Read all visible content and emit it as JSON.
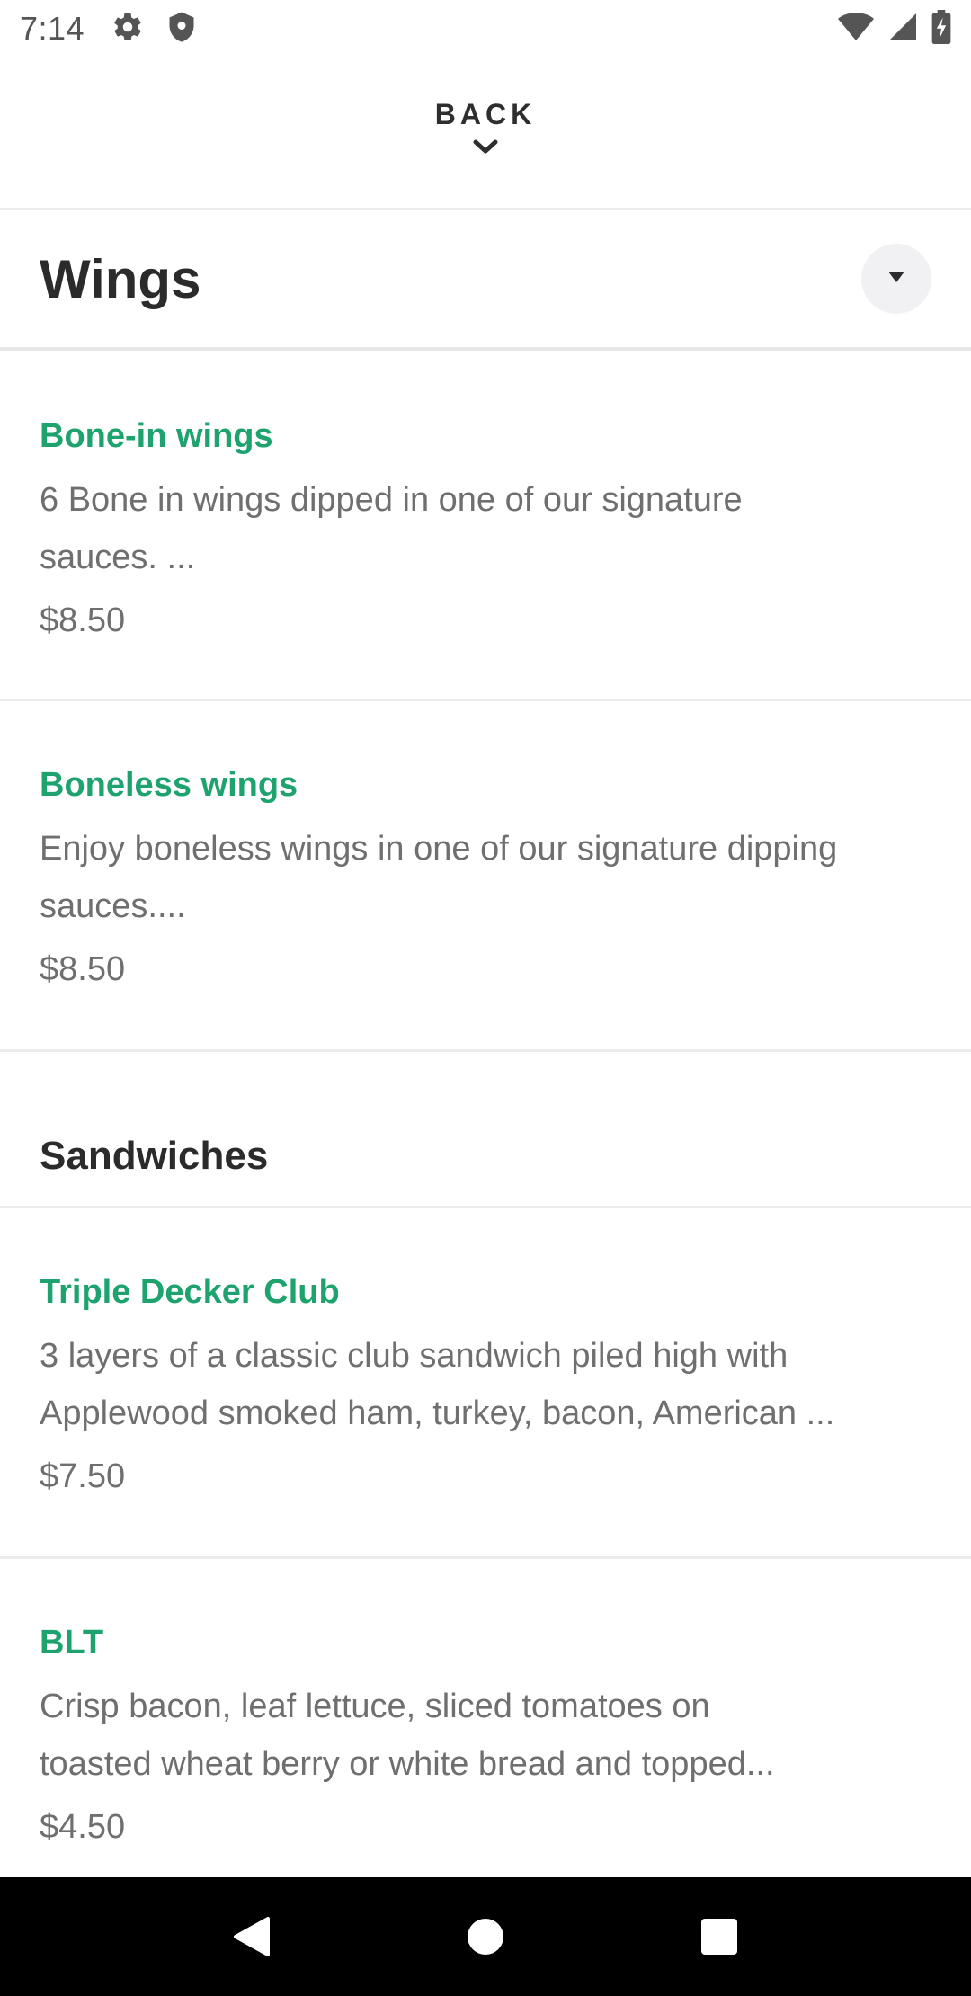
{
  "status_bar": {
    "time": "7:14",
    "left_icons": [
      "gear-icon",
      "shield-icon"
    ],
    "right_icons": [
      "wifi-icon",
      "signal-icon",
      "battery-charging-icon"
    ]
  },
  "header": {
    "back_label": "BACK",
    "chevron_icon": "chevron-down-icon"
  },
  "category": {
    "title": "Wings",
    "toggle_icon": "caret-down-icon"
  },
  "items": [
    {
      "name": "Bone-in wings",
      "description": "6 Bone in wings dipped in one of our signature\nsauces.  ...",
      "price": "$8.50"
    },
    {
      "name": "Boneless wings",
      "description": "Enjoy boneless wings in one of our signature dipping\nsauces....",
      "price": "$8.50"
    },
    {
      "name": "Triple Decker Club",
      "description": "3 layers of a classic club sandwich piled high with\nApplewood smoked ham, turkey, bacon, American ...",
      "price": "$7.50"
    },
    {
      "name": "BLT",
      "description": "Crisp bacon, leaf lettuce, sliced tomatoes on\ntoasted wheat berry or white bread and topped...",
      "price": "$4.50"
    }
  ],
  "section": {
    "title": "Sandwiches"
  },
  "nav_bar": {
    "buttons": [
      "back-triangle-icon",
      "home-circle-icon",
      "recents-square-icon"
    ]
  },
  "colors": {
    "accent_green": "#1ea36f",
    "text_dark": "#2b2b2b",
    "text_muted": "#6f6f6f",
    "divider": "#ececec"
  }
}
